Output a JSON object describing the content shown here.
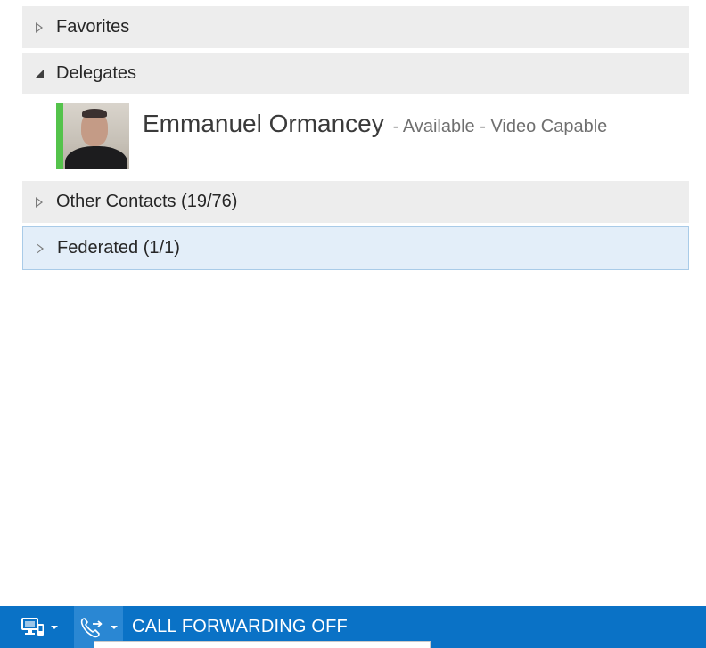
{
  "groups": {
    "favorites": {
      "label": "Favorites",
      "expanded": false
    },
    "delegates": {
      "label": "Delegates",
      "expanded": true
    },
    "other_contacts": {
      "label": "Other Contacts (19/76)",
      "expanded": false
    },
    "federated": {
      "label": "Federated (1/1)",
      "expanded": false,
      "selected": true
    }
  },
  "delegate_contact": {
    "name": "Emmanuel Ormancey",
    "status": "- Available - Video Capable",
    "presence_color": "#54c34b",
    "avatar": "user-photo"
  },
  "status_bar": {
    "background": "#0a72c6",
    "display_icon": "monitor-phone-icon",
    "forward_icon": "call-forwarding-icon",
    "call_forwarding_label": "CALL FORWARDING OFF"
  }
}
